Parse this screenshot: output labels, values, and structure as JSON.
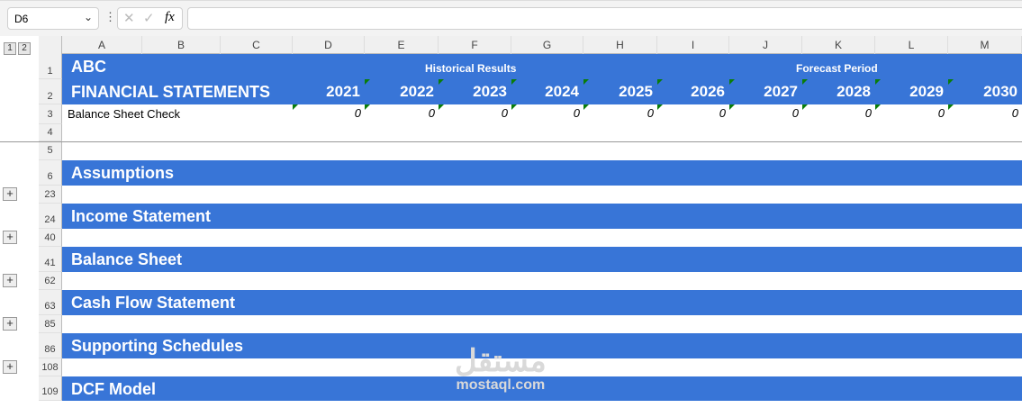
{
  "formula_bar": {
    "name_box": "D6",
    "cancel_icon": "✕",
    "enter_icon": "✓",
    "fx_label": "fx",
    "formula": ""
  },
  "outline_levels": [
    "1",
    "2"
  ],
  "columns": [
    "A",
    "B",
    "C",
    "D",
    "E",
    "F",
    "G",
    "H",
    "I",
    "J",
    "K",
    "L",
    "M"
  ],
  "header": {
    "company": "ABC",
    "title": "FINANCIAL STATEMENTS",
    "historical_label": "Historical Results",
    "forecast_label": "Forecast Period",
    "years": [
      "2021",
      "2022",
      "2023",
      "2024",
      "2025",
      "2026",
      "2027",
      "2028",
      "2029",
      "2030"
    ]
  },
  "check": {
    "label": "Balance Sheet Check",
    "values": [
      "0",
      "0",
      "0",
      "0",
      "0",
      "0",
      "0",
      "0",
      "0",
      "0"
    ]
  },
  "row_numbers_top": [
    "1",
    "2",
    "3",
    "4",
    "5"
  ],
  "sections": [
    {
      "row": "6",
      "title": "Assumptions",
      "gap_row": "23"
    },
    {
      "row": "24",
      "title": "Income Statement",
      "gap_row": "40"
    },
    {
      "row": "41",
      "title": "Balance Sheet",
      "gap_row": "62"
    },
    {
      "row": "63",
      "title": "Cash Flow Statement",
      "gap_row": "85"
    },
    {
      "row": "86",
      "title": "Supporting Schedules",
      "gap_row": "108"
    },
    {
      "row": "109",
      "title": "DCF Model"
    }
  ],
  "watermark": {
    "arabic": "مستقل",
    "latin": "mostaql.com"
  },
  "colors": {
    "band": "#3875d7",
    "flag": "#0a7d0a"
  }
}
